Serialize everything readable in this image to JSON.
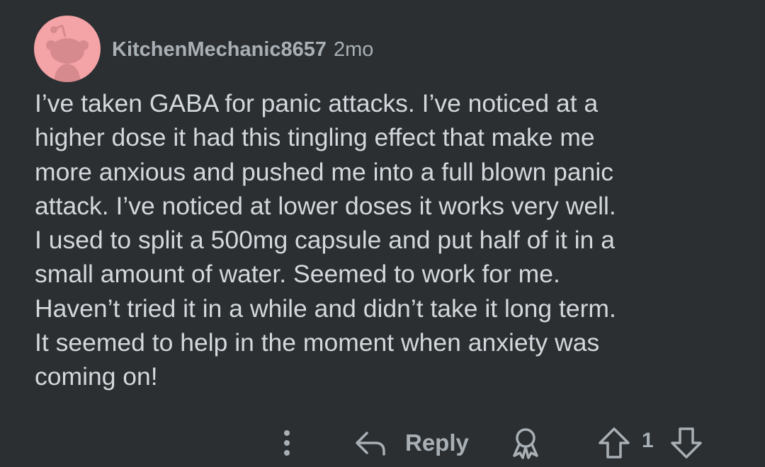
{
  "comment": {
    "author": "KitchenMechanic8657",
    "age": "2mo",
    "avatar_color": "#f4a3a6",
    "body_lines": [
      "I’ve taken GABA for panic attacks. I’ve noticed at a",
      "higher dose it had this tingling effect that make me",
      "more anxious and pushed me into a full blown panic",
      "attack. I’ve noticed at lower doses it works very well.",
      "I used to split a 500mg capsule and put half of it in a",
      "small amount of water. Seemed to work for me.",
      "Haven’t tried it in a while and didn’t take it long term.",
      "It seemed to help in the moment when anxiety was",
      "coming on!"
    ]
  },
  "actions": {
    "more_icon": "vertical-dots",
    "reply_icon": "reply-arrow",
    "reply_label": "Reply",
    "award_icon": "award-ribbon",
    "upvote_icon": "up-arrow-outline",
    "vote_count": "1",
    "downvote_icon": "down-arrow-outline"
  },
  "colors": {
    "background": "#2b2f32",
    "text": "#d3d8dc",
    "muted": "#a9b0b5"
  }
}
